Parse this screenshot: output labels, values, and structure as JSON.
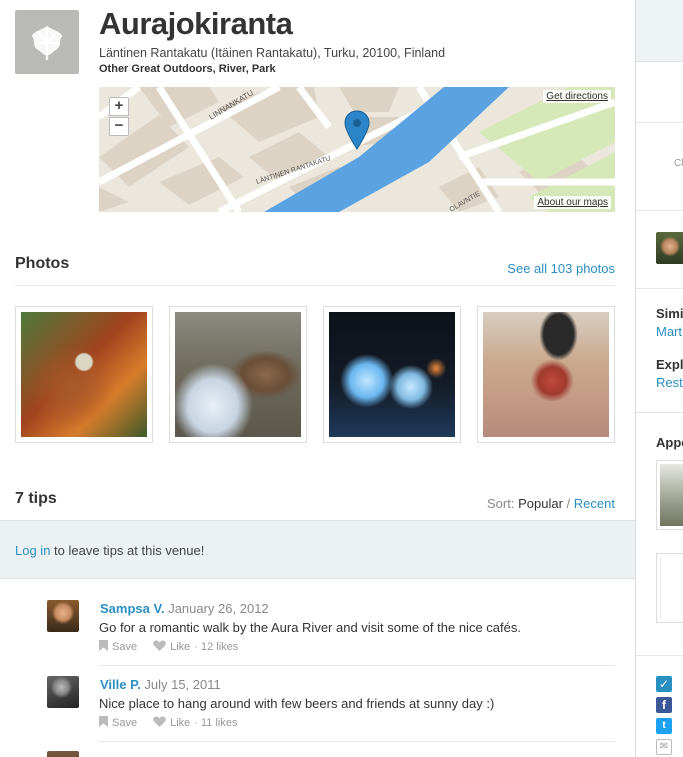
{
  "venue": {
    "title": "Aurajokiranta",
    "address": "Läntinen Rantakatu (Itäinen Rantakatu), Turku, 20100, Finland",
    "categories": "Other Great Outdoors, River, Park",
    "icon": "leaf-icon"
  },
  "map": {
    "zoom_in": "+",
    "zoom_out": "−",
    "directions_link": "Get directions",
    "about_link": "About our maps",
    "street_labels": [
      "LINNANKATU",
      "LÄNTINEN RANTAKATU",
      "OLAVNTIE"
    ],
    "colors": {
      "river": "#5ba2e2",
      "land": "#ece7dd",
      "building": "#dcd3c4",
      "park": "#d6e7b8",
      "marker": "#2b85c8"
    }
  },
  "photos": {
    "heading": "Photos",
    "see_all": "See all 103 photos",
    "items": [
      "photo-tree",
      "photo-dog",
      "photo-lanterns",
      "photo-umbrella"
    ]
  },
  "tips": {
    "heading": "7 tips",
    "sort_label": "Sort:",
    "sort_popular": "Popular",
    "sort_separator": "/",
    "sort_recent": "Recent",
    "login_link": "Log in",
    "login_rest": "to leave tips at this venue!",
    "save_label": "Save",
    "like_label": "Like",
    "items": [
      {
        "user": "Sampsa V.",
        "date": "January 26, 2012",
        "text": "Go for a romantic walk by the Aura River and visit some of the nice cafés.",
        "likes": "· 12 likes"
      },
      {
        "user": "Ville P.",
        "date": "July 15, 2011",
        "text": "Nice place to hang around with few beers and friends at sunny day :)",
        "likes": "· 11 likes"
      },
      {
        "user": "",
        "date": "",
        "text": "",
        "likes": ""
      }
    ]
  },
  "sidebar": {
    "similar_label": "Simi",
    "similar_link": "Mart",
    "explore_label": "Expl",
    "explore_link": "Rest",
    "appears_label": "Appe",
    "small_text": "Cl",
    "social_icons": [
      "foursquare-icon",
      "facebook-icon",
      "twitter-icon",
      "email-icon"
    ],
    "social_colors": {
      "facebook": "#3b5998",
      "twitter": "#1da1f2",
      "foursquare": "#2a8fc2"
    }
  }
}
